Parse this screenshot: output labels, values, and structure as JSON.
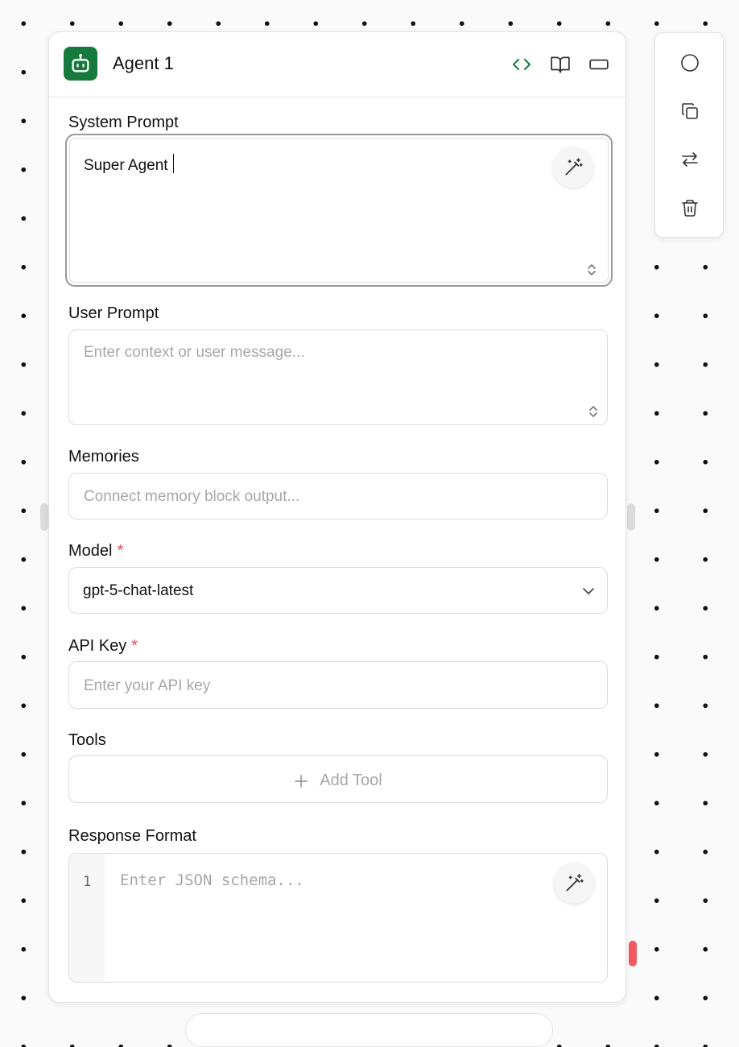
{
  "block": {
    "title": "Agent 1",
    "icon": "robot-icon",
    "accent_color": "#167a3d",
    "header_actions": [
      "code-icon",
      "book-open-icon",
      "collapse-panel-icon"
    ]
  },
  "fields": {
    "system_prompt": {
      "label": "System Prompt",
      "value": "Super Agent"
    },
    "user_prompt": {
      "label": "User Prompt",
      "placeholder": "Enter context or user message..."
    },
    "memories": {
      "label": "Memories",
      "placeholder": "Connect memory block output..."
    },
    "model": {
      "label": "Model",
      "required_mark": "*",
      "value": "gpt-5-chat-latest"
    },
    "api_key": {
      "label": "API Key",
      "required_mark": "*",
      "placeholder": "Enter your API key"
    },
    "tools": {
      "label": "Tools",
      "add_label": "Add Tool"
    },
    "response_format": {
      "label": "Response Format",
      "line_number": "1",
      "placeholder": "Enter JSON schema..."
    }
  },
  "side_toolbar": [
    "circle-icon",
    "copy-icon",
    "swap-arrows-icon",
    "trash-icon"
  ],
  "colors": {
    "required": "#e5484d",
    "error_handle": "#f15b5f"
  }
}
